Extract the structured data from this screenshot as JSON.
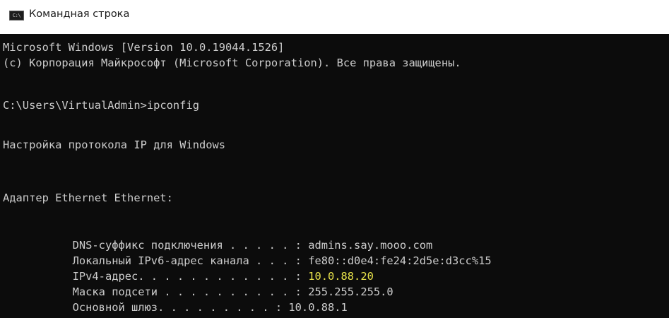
{
  "window": {
    "title": "Командная строка",
    "icon": "cmd-icon",
    "icon_glyph": "C:\\"
  },
  "console": {
    "lines": [
      "Microsoft Windows [Version 10.0.19044.1526]",
      "(c) Корпорация Майкрософт (Microsoft Corporation). Все права защищены.",
      "C:\\Users\\VirtualAdmin>ipconfig",
      "Настройка протокола IP для Windows",
      "Адаптер Ethernet Ethernet:"
    ],
    "config": [
      {
        "label": "DNS-суффикс подключения . . . . . : ",
        "value": "admins.say.mooo.com"
      },
      {
        "label": "Локальный IPv6-адрес канала . . . : ",
        "value": "fe80::d0e4:fe24:2d5e:d3cc%15"
      },
      {
        "label": "IPv4-адрес. . . . . . . . . . . . : ",
        "value": "10.0.88.20"
      },
      {
        "label": "Маска подсети . . . . . . . . . . : ",
        "value": "255.255.255.0"
      },
      {
        "label": "Основной шлюз. . . . . . . . . : ",
        "value": "10.0.88.1"
      }
    ]
  },
  "colors": {
    "console_background": "#0c0c0c",
    "console_text": "#cccccc",
    "highlight_text": "#e8e24a"
  }
}
